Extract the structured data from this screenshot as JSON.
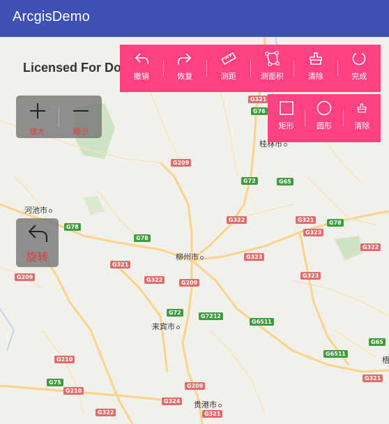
{
  "app": {
    "title": "ArcgisDemo"
  },
  "map": {
    "watermark": "Licensed For Do",
    "cities": [
      {
        "name": "河池市"
      },
      {
        "name": "柳州市"
      },
      {
        "name": "来宾市"
      },
      {
        "name": "贵港市"
      },
      {
        "name": "桂林市"
      },
      {
        "name": "梧"
      }
    ],
    "road_shields": {
      "red": [
        "G321",
        "G209",
        "G72",
        "G322",
        "G323",
        "G322",
        "G209",
        "G210",
        "G210",
        "G210",
        "G324",
        "G322",
        "G321",
        "G323",
        "G322",
        "G321",
        "G323",
        "G322",
        "G209",
        "G321",
        "G321"
      ],
      "green": [
        "G76",
        "G65",
        "G78",
        "G78",
        "G72",
        "G7212",
        "G6511",
        "G75",
        "G65",
        "G6511",
        "G78"
      ]
    }
  },
  "toolbar": {
    "undo": "撤销",
    "redo": "恢复",
    "measure_distance": "测距",
    "measure_area": "测面积",
    "clear": "清除",
    "done": "完成"
  },
  "shape_toolbar": {
    "rectangle": "矩形",
    "circle": "圆形",
    "clear": "清除"
  },
  "zoom": {
    "in": "放大",
    "out": "缩小"
  },
  "rotate": {
    "label": "旋转"
  },
  "colors": {
    "appbar": "#3f51b5",
    "toolbar": "#ff4081",
    "accent_red": "#e23c3c"
  }
}
